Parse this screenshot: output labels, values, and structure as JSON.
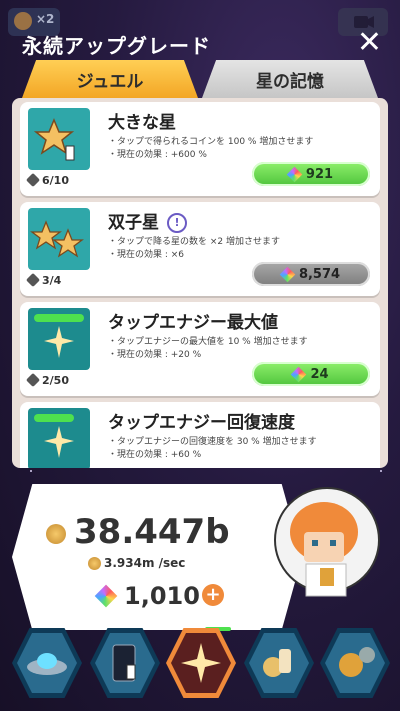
{
  "topbar": {
    "multiplier_label": "×2"
  },
  "header": {
    "title": "永続アップグレード",
    "close_label": "✕"
  },
  "tabs": [
    {
      "label": "ジュエル",
      "active": true
    },
    {
      "label": "星の記憶",
      "active": false
    }
  ],
  "upgrades": [
    {
      "name": "大きな星",
      "desc1": "・タップで得られるコインを 100 % 増加させます",
      "desc2": "・現在の効果 : +600 %",
      "level": "6/10",
      "cost": "921",
      "affordable": true,
      "icon": "star-tap-icon"
    },
    {
      "name": "双子星",
      "has_info": true,
      "info_label": "!",
      "desc1": "・タップで降る星の数を ×2 増加させます",
      "desc2": "・現在の効果 : ×6",
      "level": "3/4",
      "cost": "8,574",
      "affordable": false,
      "icon": "twin-star-icon"
    },
    {
      "name": "タップエナジー最大値",
      "desc1": "・タップエナジーの最大値を 10 % 増加させます",
      "desc2": "・現在の効果 : +20 %",
      "level": "2/50",
      "cost": "24",
      "affordable": true,
      "icon": "energy-star-icon",
      "energy_fill": 1.0
    },
    {
      "name": "タップエナジー回復速度",
      "desc1": "・タップエナジーの回復速度を 30 % 増加させます",
      "desc2": "・現在の効果 : +60 %",
      "icon": "energy-recovery-icon",
      "energy_fill": 0.8
    }
  ],
  "stats": {
    "coins": "38.447b",
    "rate": "3.934m /sec",
    "jewels": "1,010"
  },
  "nav": [
    {
      "name": "ufo",
      "icon": "ufo-icon"
    },
    {
      "name": "phone",
      "icon": "phone-tap-icon"
    },
    {
      "name": "star",
      "icon": "sparkle-star-icon",
      "active": true
    },
    {
      "name": "items",
      "icon": "items-icon"
    },
    {
      "name": "settings",
      "icon": "medal-gear-icon"
    }
  ],
  "colors": {
    "accent_green": "#4fc43c",
    "tab_active": "#f3a625",
    "thumb_teal": "#2fa7a9",
    "nav_active_border": "#f08a3a"
  }
}
